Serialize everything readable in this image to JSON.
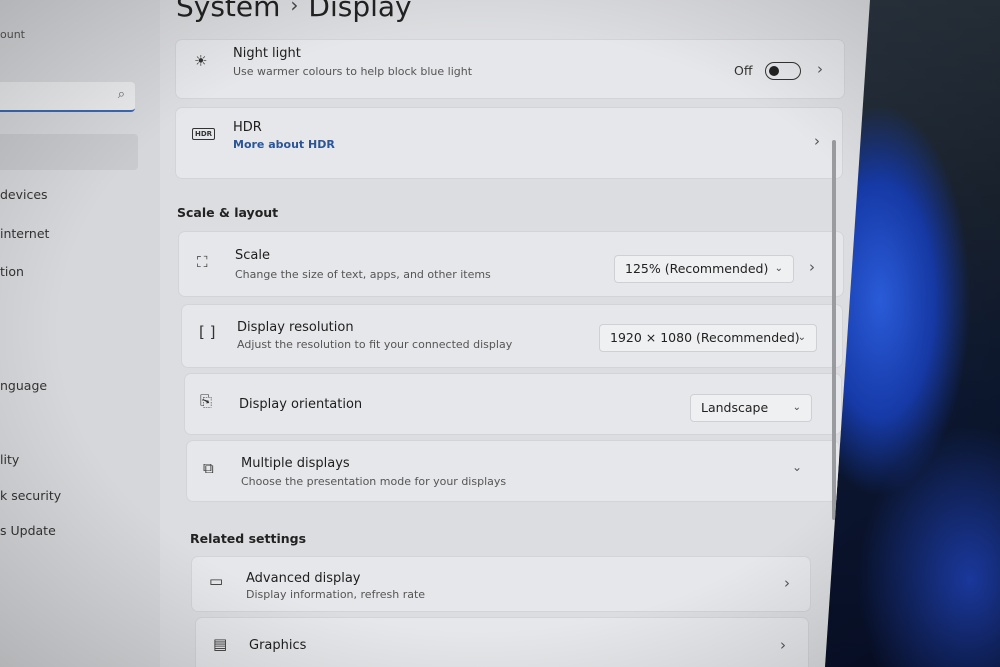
{
  "header": {
    "breadcrumb_parent": "System",
    "separator": "›",
    "title": "Display"
  },
  "sidebar": {
    "account_fragment": "ount",
    "search_icon": "search-icon",
    "items": [
      {
        "label": "devices"
      },
      {
        "label": "internet"
      },
      {
        "label": "tion"
      },
      {
        "label": "nguage"
      },
      {
        "label": "lity"
      },
      {
        "label": "k security"
      },
      {
        "label": "s Update"
      }
    ]
  },
  "night_light": {
    "title": "Night light",
    "subtitle": "Use warmer colours to help block blue light",
    "state_label": "Off",
    "enabled": false
  },
  "hdr": {
    "title": "HDR",
    "link": "More about HDR",
    "icon_text": "HDR"
  },
  "scale_layout": {
    "heading": "Scale & layout",
    "scale": {
      "title": "Scale",
      "subtitle": "Change the size of text, apps, and other items",
      "value": "125% (Recommended)"
    },
    "resolution": {
      "title": "Display resolution",
      "subtitle": "Adjust the resolution to fit your connected display",
      "value": "1920 × 1080 (Recommended)"
    },
    "orientation": {
      "title": "Display orientation",
      "value": "Landscape"
    },
    "multiple": {
      "title": "Multiple displays",
      "subtitle": "Choose the presentation mode for your displays"
    }
  },
  "related": {
    "heading": "Related settings",
    "advanced": {
      "title": "Advanced display",
      "subtitle": "Display information, refresh rate"
    },
    "graphics": {
      "title": "Graphics"
    }
  }
}
